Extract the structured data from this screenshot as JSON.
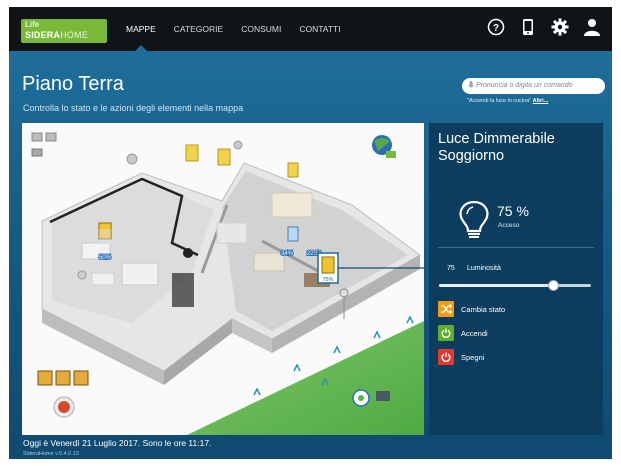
{
  "app": {
    "logo_line1": "Life",
    "logo_line2_a": "SIDERA",
    "logo_line2_b": "HOME",
    "version": "SideraHome v.5.4.0.13"
  },
  "nav": {
    "items": [
      {
        "label": "MAPPE",
        "active": true
      },
      {
        "label": "CATEGORIE",
        "active": false
      },
      {
        "label": "CONSUMI",
        "active": false
      },
      {
        "label": "CONTATTI",
        "active": false
      }
    ]
  },
  "top_icons": [
    "help-icon",
    "phone-icon",
    "gear-icon",
    "user-icon"
  ],
  "page": {
    "title": "Piano Terra",
    "subtitle": "Controlla lo stato e le azioni degli elementi nella mappa"
  },
  "voice": {
    "placeholder": "Pronuncia o digita un comando",
    "hint": "\"Accendi la luce in cucina\"",
    "hint_link": "Altri..."
  },
  "map": {
    "labels": {
      "room1_percent": "50%",
      "room2_percent": "34%",
      "room2_temp": "22.5°",
      "selected_percent": "75%"
    }
  },
  "panel": {
    "title": "Luce Dimmerabile Soggiorno",
    "value": "75 %",
    "state": "Acceso",
    "brightness_value": "75",
    "brightness_label": "Luminosità",
    "brightness_level": 0.75,
    "actions": [
      {
        "label": "Cambia stato",
        "color": "#f39c12",
        "icon": "shuffle-icon"
      },
      {
        "label": "Accendi",
        "color": "#5fae2e",
        "icon": "power-icon"
      },
      {
        "label": "Spegni",
        "color": "#e23b2e",
        "icon": "power-icon"
      }
    ]
  },
  "footer": {
    "date_text": "Oggi è Venerdì 21 Luglio 2017. Sono le ore 11:17."
  },
  "colors": {
    "topbar": "#111417",
    "accent_green": "#7ab83a",
    "panel": "#0d3d5e"
  }
}
